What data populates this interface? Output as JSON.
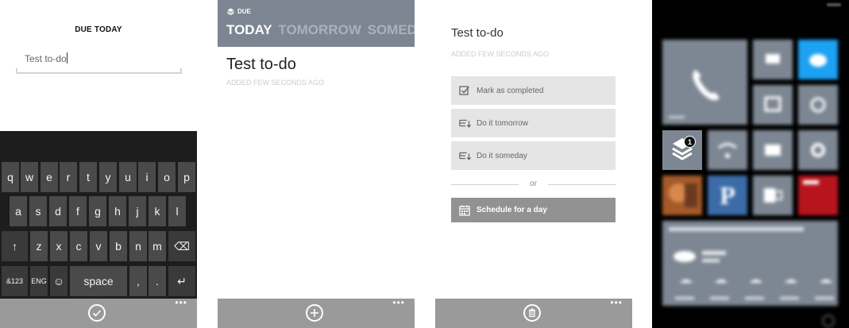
{
  "panel1": {
    "title": "DUE TODAY",
    "input_value": "Test to-do",
    "keyboard": {
      "row1": [
        "q",
        "w",
        "e",
        "r",
        "t",
        "y",
        "u",
        "i",
        "o",
        "p"
      ],
      "row2": [
        "a",
        "s",
        "d",
        "f",
        "g",
        "h",
        "j",
        "k",
        "l"
      ],
      "row3": [
        "z",
        "x",
        "c",
        "v",
        "b",
        "n",
        "m"
      ],
      "shift_key": "↑",
      "backspace_key": "⌫",
      "symbols_key": "&123",
      "language_key": "ENG",
      "emoji_key": "☺",
      "space_key": "space",
      "comma_key": ",",
      "period_key": ".",
      "enter_key": "↵"
    },
    "appbar_dots": "•••"
  },
  "panel2": {
    "header_label": "DUE",
    "tabs": [
      "TODAY",
      "TOMORROW",
      "SOMEDAY"
    ],
    "item_title": "Test to-do",
    "item_subtitle": "ADDED FEW SECONDS AGO",
    "appbar_dots": "•••"
  },
  "panel3": {
    "title": "Test to-do",
    "subtitle": "ADDED FEW SECONDS AGO",
    "actions": [
      "Mark as completed",
      "Do it tomorrow",
      "Do it someday"
    ],
    "or_text": "or",
    "schedule_label": "Schedule for a day",
    "appbar_dots": "•••"
  },
  "panel4": {
    "badge_count": "1",
    "tile_letter": "P",
    "colors": {
      "twitter": "#1da1f2",
      "news_red": "#b8141d",
      "pinterest": "#3b6ca8",
      "tile_gray": "#7d8793"
    }
  }
}
